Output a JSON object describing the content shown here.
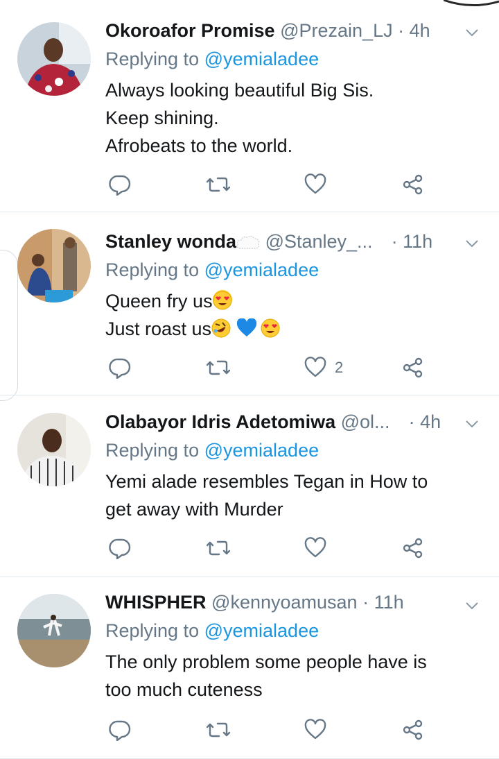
{
  "tweets": [
    {
      "name": "Okoroafor Promise",
      "handle": "@Prezain_LJ",
      "dot": "·",
      "time": "4h",
      "replying_prefix": "Replying to",
      "replying_to": "@yemialadee",
      "lines": [
        "Always looking beautiful Big Sis.",
        "Keep shining.",
        "Afrobeats to the world."
      ],
      "like_count": ""
    },
    {
      "name": "Stanley wonda",
      "handle": "@Stanley_...",
      "dot": "·",
      "time": "11h",
      "replying_prefix": "Replying to",
      "replying_to": "@yemialadee",
      "lines": [
        "Queen fry us",
        "Just roast us"
      ],
      "like_count": "2"
    },
    {
      "name": "Olabayor Idris Adetomiwa",
      "handle": "@ol...",
      "dot": "·",
      "time": "4h",
      "replying_prefix": "Replying to",
      "replying_to": "@yemialadee",
      "lines": [
        "Yemi alade resembles Tegan in How to",
        "get away with Murder"
      ],
      "like_count": ""
    },
    {
      "name": "WHISPHER",
      "handle": "@kennyoamusan",
      "dot": "·",
      "time": "11h",
      "replying_prefix": "Replying to",
      "replying_to": "@yemialadee",
      "lines": [
        "The only problem some people have is",
        "too much cuteness"
      ],
      "like_count": ""
    }
  ],
  "icons": {
    "reply": "reply-icon",
    "retweet": "retweet-icon",
    "like": "heart-icon",
    "share": "share-icon",
    "menu": "chevron-down-icon"
  },
  "colors": {
    "text": "#14171a",
    "secondary": "#657786",
    "mention": "#1b95e0",
    "divider": "#e1e8ed"
  }
}
